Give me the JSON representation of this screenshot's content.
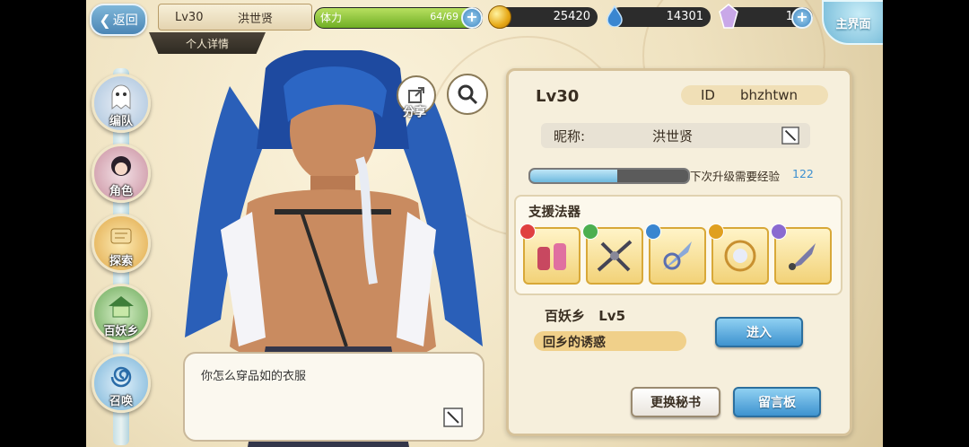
{
  "topbar": {
    "back_label": "返回",
    "level": "Lv30",
    "name": "洪世贤",
    "profile_tab": "个人详情",
    "stamina_label": "体力",
    "stamina_value": "64/69",
    "stamina_ratio": 0.93,
    "gold": "25420",
    "spirit": "14301",
    "crystal": "1",
    "home_label": "主界面",
    "colors": {
      "gold_coin": "#e6a816",
      "stamina_fill": "#6fae24",
      "accent_blue": "#3e93cf"
    }
  },
  "nav": {
    "items": [
      {
        "label": "编队",
        "icon": "ghost-icon"
      },
      {
        "label": "角色",
        "icon": "girl-portrait-icon"
      },
      {
        "label": "探索",
        "icon": "scroll-icon"
      },
      {
        "label": "百妖乡",
        "icon": "house-icon"
      },
      {
        "label": "召唤",
        "icon": "swirl-icon"
      }
    ]
  },
  "character": {
    "share_label": "分享",
    "speech": "你怎么穿品如的衣服"
  },
  "panel": {
    "level": "Lv30",
    "id_label": "ID",
    "id_value": "bhzhtwn",
    "nickname_label": "昵称:",
    "nickname_value": "洪世贤",
    "exp_label": "下次升级需要经验",
    "exp_value": "122",
    "exp_ratio": 0.55,
    "support_label": "支援法器",
    "support_items": [
      {
        "icon": "potion-bottles-icon",
        "element": "#e04040"
      },
      {
        "icon": "crossbow-icon",
        "element": "#4caf50"
      },
      {
        "icon": "blade-icon",
        "element": "#3a86d0"
      },
      {
        "icon": "orb-ring-icon",
        "element": "#e0a020"
      },
      {
        "icon": "dagger-icon",
        "element": "#8a6ad0"
      }
    ],
    "village_label": "百妖乡",
    "village_level": "Lv5",
    "lure_text": "回乡的诱惑",
    "enter_button": "进入",
    "change_secretary": "更换秘书",
    "message_board": "留言板"
  }
}
